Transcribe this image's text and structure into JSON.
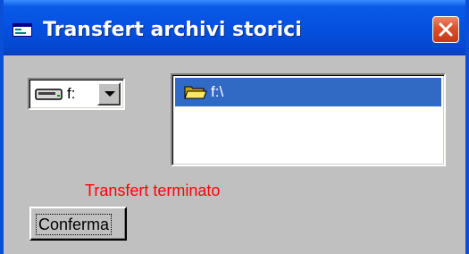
{
  "window": {
    "title": "Transfert archivi storici",
    "title_icon": "app-window-icon",
    "close_icon": "close-icon"
  },
  "drive_selector": {
    "icon": "drive-icon",
    "selected_value": "f:"
  },
  "directory_list": {
    "items": [
      {
        "icon": "open-folder-icon",
        "label": "f:\\",
        "selected": true
      }
    ]
  },
  "status": {
    "message": "Transfert terminato",
    "color": "#ff0000"
  },
  "actions": {
    "confirm_label": "Conferma"
  },
  "colors": {
    "titlebar": "#0550e0",
    "selection": "#316ac5",
    "dialog_face": "#c0c0c0"
  }
}
